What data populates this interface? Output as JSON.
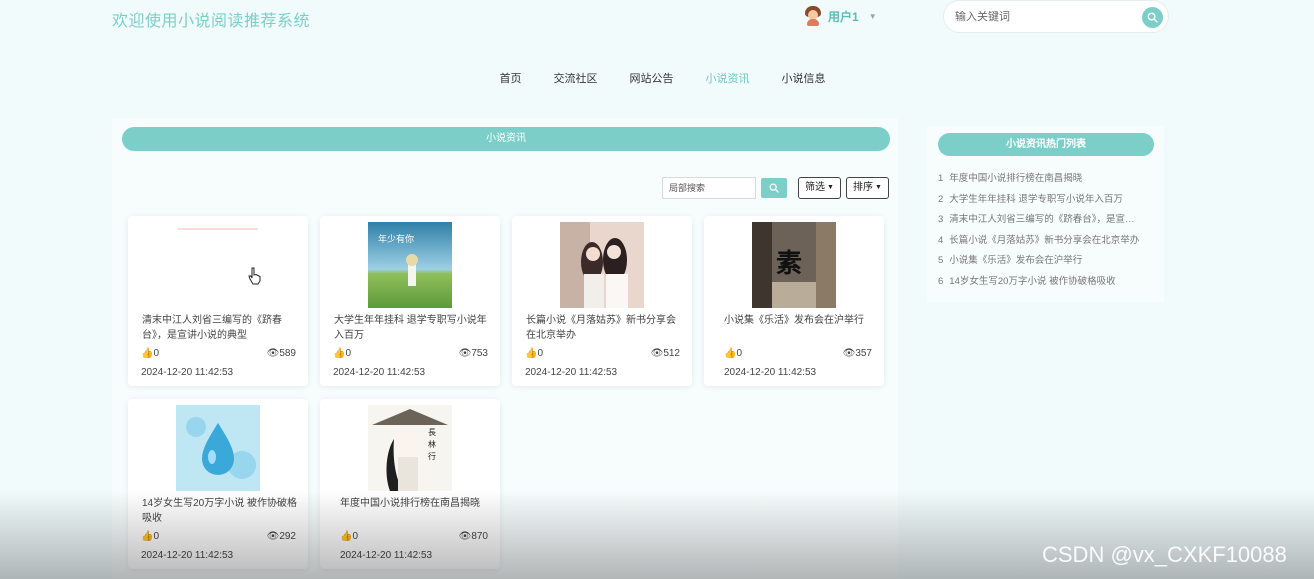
{
  "header": {
    "site_title": "欢迎使用小说阅读推荐系统",
    "user_name": "用户1",
    "search_placeholder": "输入关键词"
  },
  "nav": {
    "items": [
      {
        "label": "首页"
      },
      {
        "label": "交流社区"
      },
      {
        "label": "网站公告"
      },
      {
        "label": "小说资讯",
        "active": true
      },
      {
        "label": "小说信息"
      }
    ]
  },
  "main": {
    "section_title": "小说资讯",
    "local_search_placeholder": "局部搜索",
    "filter_label": "筛选",
    "sort_label": "排序",
    "cards": [
      {
        "title": "清末中江人刘省三编写的《跻春台》，是宣讲小说的典型",
        "likes": "0",
        "views": "589",
        "date": "2024-12-20 11:42:53",
        "cover": "blank"
      },
      {
        "title": "大学生年年挂科 退学专职写小说年入百万",
        "likes": "0",
        "views": "753",
        "date": "2024-12-20 11:42:53",
        "cover": "book-girl-field"
      },
      {
        "title": "长篇小说《月落姑苏》新书分享会在北京举办",
        "likes": "0",
        "views": "512",
        "date": "2024-12-20 11:42:53",
        "cover": "two-girls"
      },
      {
        "title": "小说集《乐活》发布会在沪举行",
        "likes": "0",
        "views": "357",
        "date": "2024-12-20 11:42:53",
        "cover": "calligraphy-street"
      },
      {
        "title": "14岁女生写20万字小说 被作协破格吸收",
        "likes": "0",
        "views": "292",
        "date": "2024-12-20 11:42:53",
        "cover": "water-drop"
      },
      {
        "title": "年度中国小说排行榜在南昌揭晓",
        "likes": "0",
        "views": "870",
        "date": "2024-12-20 11:42:53",
        "cover": "ink-swordsman"
      }
    ]
  },
  "sidebar": {
    "title": "小说资讯热门列表",
    "items": [
      {
        "num": "1",
        "text": "年度中国小说排行榜在南昌揭晓"
      },
      {
        "num": "2",
        "text": "大学生年年挂科 退学专职写小说年入百万"
      },
      {
        "num": "3",
        "text": "清末中江人刘省三编写的《跻春台》，是宣…"
      },
      {
        "num": "4",
        "text": "长篇小说《月落姑苏》新书分享会在北京举办"
      },
      {
        "num": "5",
        "text": "小说集《乐活》发布会在沪举行"
      },
      {
        "num": "6",
        "text": "14岁女生写20万字小说 被作协破格吸收"
      }
    ]
  },
  "watermark": "CSDN @vx_CXKF10088",
  "colors": {
    "accent": "#7ccfc9",
    "background": "#f1fbfc"
  }
}
